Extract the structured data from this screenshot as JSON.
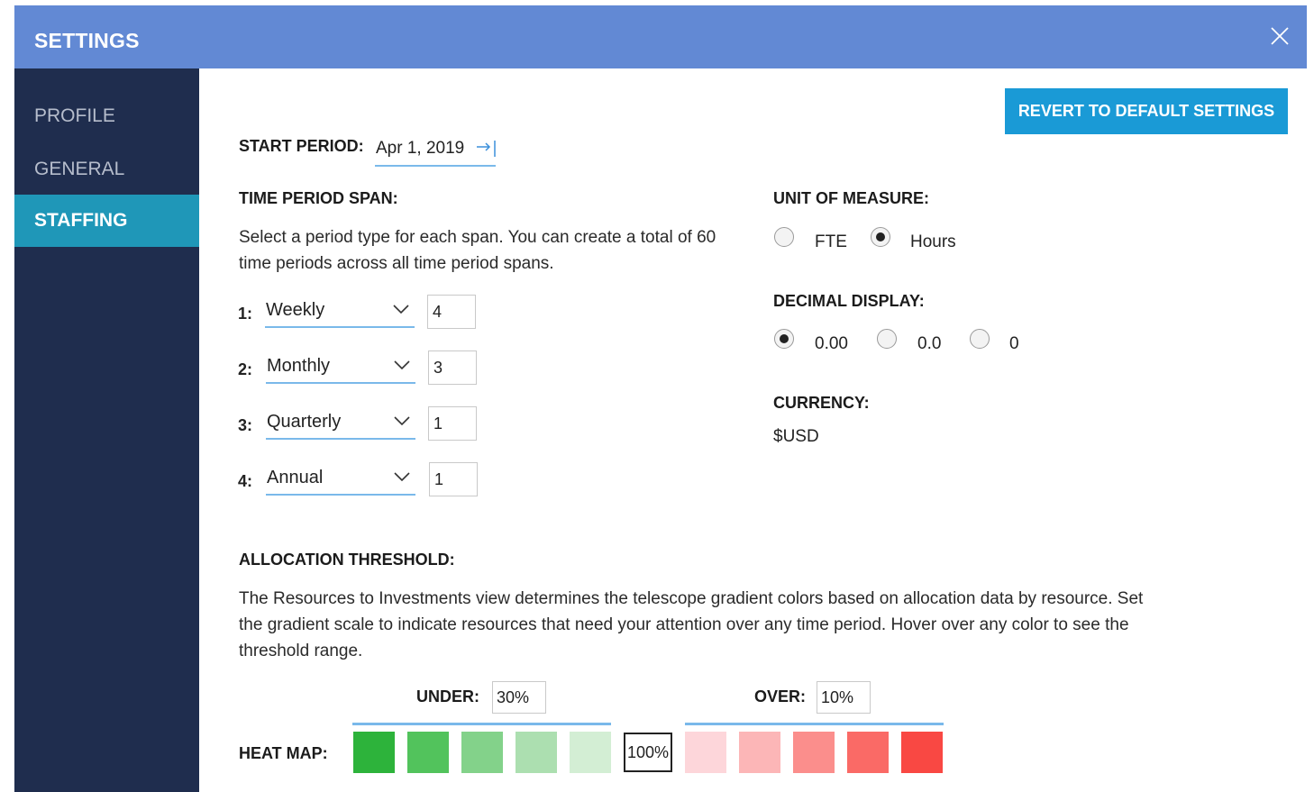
{
  "header": {
    "title": "SETTINGS"
  },
  "sidebar": {
    "items": [
      {
        "label": "PROFILE",
        "active": false
      },
      {
        "label": "GENERAL",
        "active": false
      },
      {
        "label": "STAFFING",
        "active": true
      }
    ]
  },
  "toolbar": {
    "revert_label": "REVERT TO DEFAULT SETTINGS"
  },
  "start_period": {
    "label": "START PERIOD:",
    "value": "Apr 1, 2019"
  },
  "time_span": {
    "label": "TIME PERIOD SPAN:",
    "description": "Select a period type for each span. You can create a total of 60 time periods across all time period spans.",
    "rows": [
      {
        "num": "1:",
        "type": "Weekly",
        "count": "4"
      },
      {
        "num": "2:",
        "type": "Monthly",
        "count": "3"
      },
      {
        "num": "3:",
        "type": "Quarterly",
        "count": "1"
      },
      {
        "num": "4:",
        "type": "Annual",
        "count": "1"
      }
    ]
  },
  "unit_of_measure": {
    "label": "UNIT OF MEASURE:",
    "options": [
      {
        "label": "FTE",
        "selected": false
      },
      {
        "label": "Hours",
        "selected": true
      }
    ]
  },
  "decimal_display": {
    "label": "DECIMAL DISPLAY:",
    "options": [
      {
        "label": "0.00",
        "selected": true
      },
      {
        "label": "0.0",
        "selected": false
      },
      {
        "label": "0",
        "selected": false
      }
    ]
  },
  "currency": {
    "label": "CURRENCY:",
    "value": "$USD"
  },
  "allocation": {
    "label": "ALLOCATION THRESHOLD:",
    "description_lines": [
      "The Resources to Investments view determines the telescope gradient colors based on allocation data by resource. Set",
      "the gradient scale to indicate resources that need your attention over any time period. Hover over any color to see the",
      "threshold range."
    ],
    "under_label": "UNDER:",
    "under_value": "30%",
    "over_label": "OVER:",
    "over_value": "10%",
    "heat_map_label": "HEAT MAP:",
    "center_value": "100%",
    "under_colors": [
      "#2db33b",
      "#52c35c",
      "#83d28a",
      "#acdfb0",
      "#d3eed4"
    ],
    "over_colors": [
      "#fdd6da",
      "#fcb6b7",
      "#fb8e8c",
      "#fa6a66",
      "#f94843"
    ]
  }
}
